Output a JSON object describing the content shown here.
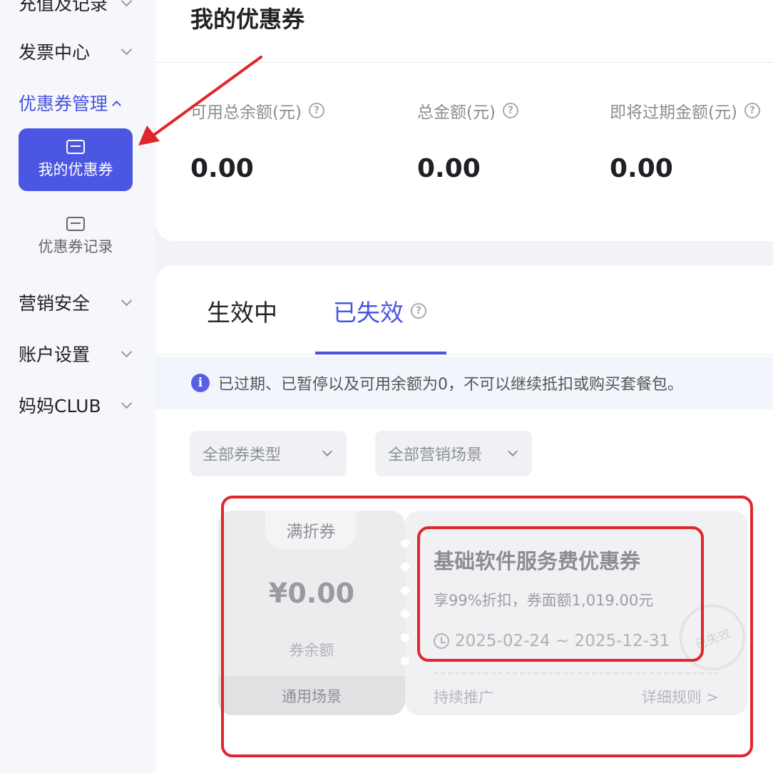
{
  "sidebar": {
    "top_partial": "充值及记录",
    "items": [
      {
        "label": "发票中心"
      },
      {
        "label": "优惠券管理"
      },
      {
        "label": "营销安全"
      },
      {
        "label": "账户设置"
      },
      {
        "label": "妈妈CLUB"
      }
    ],
    "sub_items": [
      {
        "label": "我的优惠券",
        "icon": "coupon-icon",
        "active": true
      },
      {
        "label": "优惠券记录",
        "icon": "coupon-record-icon",
        "active": false
      }
    ]
  },
  "header": {
    "title": "我的优惠券",
    "stats": [
      {
        "label": "可用总余额(元)",
        "value": "0.00"
      },
      {
        "label": "总金额(元)",
        "value": "0.00"
      },
      {
        "label": "即将过期金额(元)",
        "value": "0.00"
      }
    ],
    "help_glyph": "?"
  },
  "tabs": [
    {
      "label": "生效中",
      "active": false
    },
    {
      "label": "已失效",
      "active": true
    }
  ],
  "notice": {
    "icon_glyph": "i",
    "text": "已过期、已暂停以及可用余额为0，不可以继续抵扣或购买套餐包。"
  },
  "filters": {
    "type": "全部券类型",
    "scene": "全部营销场景"
  },
  "coupon": {
    "type_label": "满折券",
    "amount": "¥0.00",
    "amount_label": "券余额",
    "scene": "通用场景",
    "name": "基础软件服务费优惠券",
    "desc": "享99%折扣，券面额1,019.00元",
    "date_range": "2025-02-24 ~ 2025-12-31",
    "promo": "持续推广",
    "rules": "详细规则 >",
    "stamp": "已失效"
  },
  "colors": {
    "accent": "#4b57e3",
    "annotation": "#e0262c"
  }
}
